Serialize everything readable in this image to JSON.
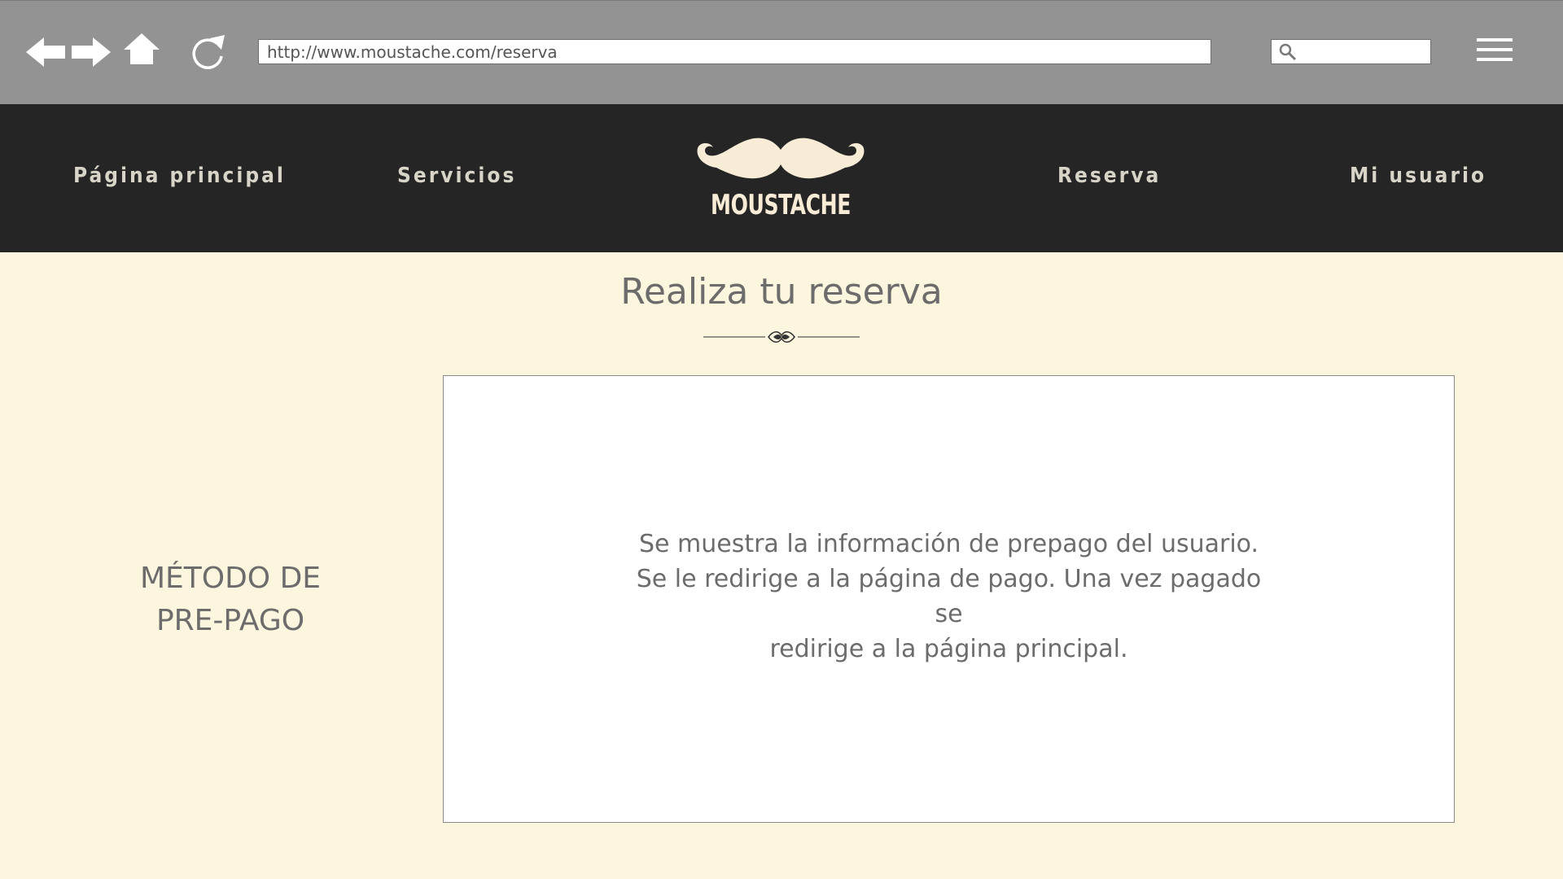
{
  "browser": {
    "url": "http://www.moustache.com/reserva",
    "search_placeholder": ""
  },
  "nav": {
    "home_label": "Página principal",
    "services_label": "Servicios",
    "booking_label": "Reserva",
    "user_label": "Mi usuario"
  },
  "logo": {
    "text": "MOUSTACHE",
    "icon": "mustache-icon"
  },
  "main": {
    "title": "Realiza tu reserva",
    "method_label_line1": "MÉTODO DE",
    "method_label_line2": "PRE-PAGO",
    "info_lines": [
      "Se muestra la información de prepago del usuario.",
      "Se le redirige a la página de pago. Una vez pagado se",
      "redirige a la página principal."
    ]
  },
  "colors": {
    "browser_bar": "#939393",
    "header_bg": "#252525",
    "page_bg": "#fdf6df",
    "logo": "#f8ecd7",
    "text": "#6c6c6c"
  }
}
